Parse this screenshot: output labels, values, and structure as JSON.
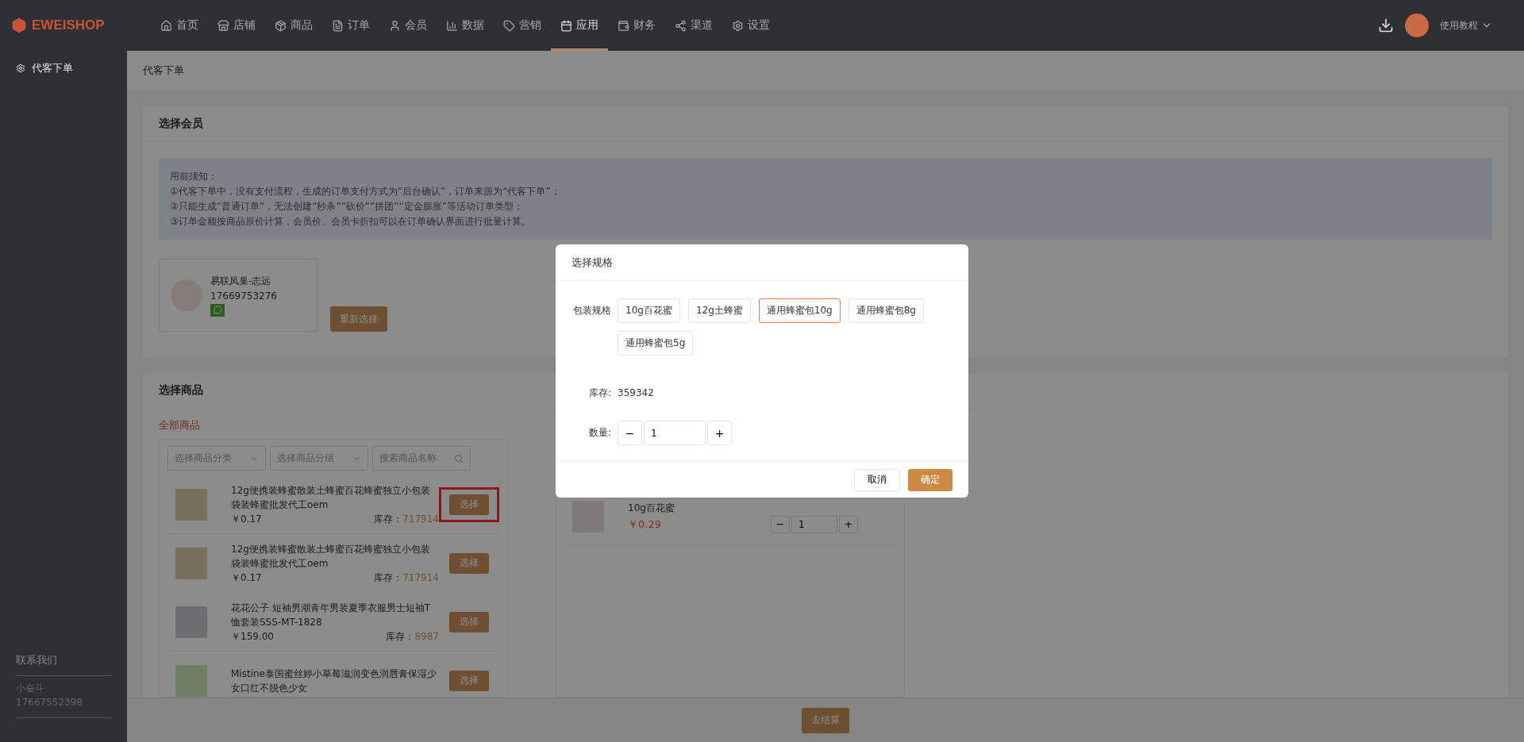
{
  "nav": {
    "logo": "EWEISHOP",
    "items": [
      {
        "label": "首页",
        "selected": false
      },
      {
        "label": "店铺",
        "selected": false
      },
      {
        "label": "商品",
        "selected": false
      },
      {
        "label": "订单",
        "selected": false
      },
      {
        "label": "会员",
        "selected": false
      },
      {
        "label": "数据",
        "selected": false
      },
      {
        "label": "营销",
        "selected": false
      },
      {
        "label": "应用",
        "selected": true
      },
      {
        "label": "财务",
        "selected": false
      },
      {
        "label": "渠道",
        "selected": false
      },
      {
        "label": "设置",
        "selected": false
      }
    ],
    "tutorial": "使用教程"
  },
  "sidebar": {
    "items": [
      {
        "label": "代客下单",
        "selected": true
      }
    ],
    "contact_title": "联系我们",
    "contact_name": "小奋斗",
    "contact_phone": "17667552398"
  },
  "breadcrumb": "代客下单",
  "member_section": {
    "title": "选择会员",
    "notice": [
      "用前须知：",
      "①代客下单中，没有支付流程，生成的订单支付方式为“后台确认”，订单来源为“代客下单”；",
      "②只能生成“普通订单”，无法创建“秒杀”“砍价”“拼团”“定金膨胀”等活动订单类型；",
      "③订单金额按商品原价计算，会员价、会员卡折扣可以在订单确认界面进行批量计算。"
    ],
    "member": {
      "name": "易联凤巢-志远",
      "phone": "17669753276"
    },
    "reselect_button": "重新选择"
  },
  "goods_section": {
    "title": "选择商品",
    "tab": "全部商品",
    "filters": {
      "category_placeholder": "选择商品分类",
      "group_placeholder": "选择商品分组",
      "search_placeholder": "搜索商品名称"
    },
    "products": [
      {
        "name": "12g便携装蜂蜜散装土蜂蜜百花蜂蜜独立小包装袋装蜂蜜批发代工oem",
        "price": "￥0.17",
        "stock_label": "库存：",
        "stock": "717914",
        "button": "选择",
        "highlighted": true
      },
      {
        "name": "12g便携装蜂蜜散装土蜂蜜百花蜂蜜独立小包装袋装蜂蜜批发代工oem",
        "price": "￥0.17",
        "stock_label": "库存：",
        "stock": "717914",
        "button": "选择",
        "highlighted": false
      },
      {
        "name": "花花公子 短袖男潮青年男装夏季衣服男士短袖T恤套装SSS-MT-1828",
        "price": "￥159.00",
        "stock_label": "库存：",
        "stock": "8987",
        "button": "选择",
        "highlighted": false
      },
      {
        "name": "Mistine泰国蜜丝婷小草莓滋润变色润唇膏保湿少女口红不脱色少女",
        "button": "选择",
        "highlighted": false
      }
    ],
    "cart": [
      {
        "name": "10g百花蜜",
        "price": "￥0.29",
        "minus": "−",
        "quantity": "1",
        "plus": "+"
      }
    ]
  },
  "checkout_button": "去结算",
  "modal": {
    "title": "选择规格",
    "spec_label": "包装规格",
    "options": [
      {
        "label": "10g百花蜜",
        "selected": false
      },
      {
        "label": "12g土蜂蜜",
        "selected": false
      },
      {
        "label": "通用蜂蜜包10g",
        "selected": true
      },
      {
        "label": "通用蜂蜜包8g",
        "selected": false
      },
      {
        "label": "通用蜂蜜包5g",
        "selected": false
      }
    ],
    "stock_label": "库存:",
    "stock": "359342",
    "quantity_label": "数量:",
    "minus": "−",
    "quantity": "1",
    "plus": "+",
    "cancel": "取消",
    "confirm": "确定"
  }
}
